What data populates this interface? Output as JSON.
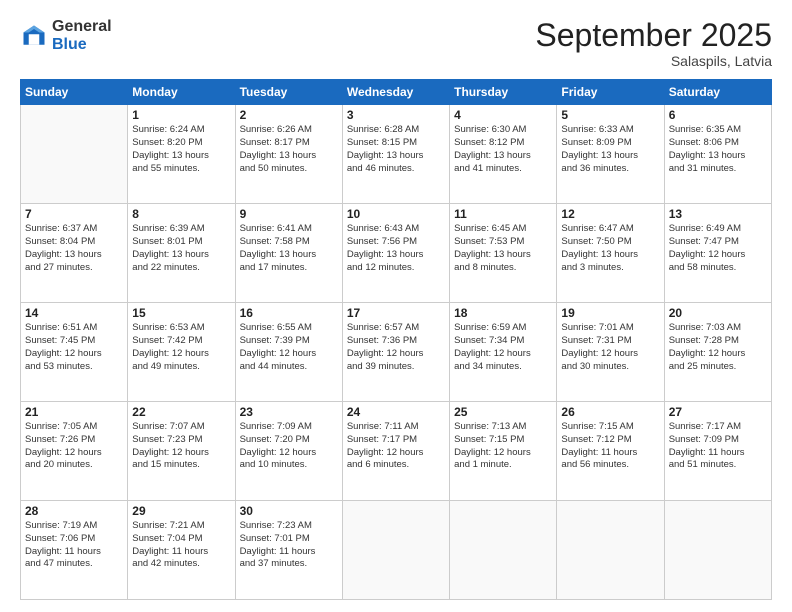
{
  "header": {
    "logo_general": "General",
    "logo_blue": "Blue",
    "month_title": "September 2025",
    "location": "Salaspils, Latvia"
  },
  "weekdays": [
    "Sunday",
    "Monday",
    "Tuesday",
    "Wednesday",
    "Thursday",
    "Friday",
    "Saturday"
  ],
  "weeks": [
    [
      {
        "day": "",
        "info": ""
      },
      {
        "day": "1",
        "info": "Sunrise: 6:24 AM\nSunset: 8:20 PM\nDaylight: 13 hours\nand 55 minutes."
      },
      {
        "day": "2",
        "info": "Sunrise: 6:26 AM\nSunset: 8:17 PM\nDaylight: 13 hours\nand 50 minutes."
      },
      {
        "day": "3",
        "info": "Sunrise: 6:28 AM\nSunset: 8:15 PM\nDaylight: 13 hours\nand 46 minutes."
      },
      {
        "day": "4",
        "info": "Sunrise: 6:30 AM\nSunset: 8:12 PM\nDaylight: 13 hours\nand 41 minutes."
      },
      {
        "day": "5",
        "info": "Sunrise: 6:33 AM\nSunset: 8:09 PM\nDaylight: 13 hours\nand 36 minutes."
      },
      {
        "day": "6",
        "info": "Sunrise: 6:35 AM\nSunset: 8:06 PM\nDaylight: 13 hours\nand 31 minutes."
      }
    ],
    [
      {
        "day": "7",
        "info": "Sunrise: 6:37 AM\nSunset: 8:04 PM\nDaylight: 13 hours\nand 27 minutes."
      },
      {
        "day": "8",
        "info": "Sunrise: 6:39 AM\nSunset: 8:01 PM\nDaylight: 13 hours\nand 22 minutes."
      },
      {
        "day": "9",
        "info": "Sunrise: 6:41 AM\nSunset: 7:58 PM\nDaylight: 13 hours\nand 17 minutes."
      },
      {
        "day": "10",
        "info": "Sunrise: 6:43 AM\nSunset: 7:56 PM\nDaylight: 13 hours\nand 12 minutes."
      },
      {
        "day": "11",
        "info": "Sunrise: 6:45 AM\nSunset: 7:53 PM\nDaylight: 13 hours\nand 8 minutes."
      },
      {
        "day": "12",
        "info": "Sunrise: 6:47 AM\nSunset: 7:50 PM\nDaylight: 13 hours\nand 3 minutes."
      },
      {
        "day": "13",
        "info": "Sunrise: 6:49 AM\nSunset: 7:47 PM\nDaylight: 12 hours\nand 58 minutes."
      }
    ],
    [
      {
        "day": "14",
        "info": "Sunrise: 6:51 AM\nSunset: 7:45 PM\nDaylight: 12 hours\nand 53 minutes."
      },
      {
        "day": "15",
        "info": "Sunrise: 6:53 AM\nSunset: 7:42 PM\nDaylight: 12 hours\nand 49 minutes."
      },
      {
        "day": "16",
        "info": "Sunrise: 6:55 AM\nSunset: 7:39 PM\nDaylight: 12 hours\nand 44 minutes."
      },
      {
        "day": "17",
        "info": "Sunrise: 6:57 AM\nSunset: 7:36 PM\nDaylight: 12 hours\nand 39 minutes."
      },
      {
        "day": "18",
        "info": "Sunrise: 6:59 AM\nSunset: 7:34 PM\nDaylight: 12 hours\nand 34 minutes."
      },
      {
        "day": "19",
        "info": "Sunrise: 7:01 AM\nSunset: 7:31 PM\nDaylight: 12 hours\nand 30 minutes."
      },
      {
        "day": "20",
        "info": "Sunrise: 7:03 AM\nSunset: 7:28 PM\nDaylight: 12 hours\nand 25 minutes."
      }
    ],
    [
      {
        "day": "21",
        "info": "Sunrise: 7:05 AM\nSunset: 7:26 PM\nDaylight: 12 hours\nand 20 minutes."
      },
      {
        "day": "22",
        "info": "Sunrise: 7:07 AM\nSunset: 7:23 PM\nDaylight: 12 hours\nand 15 minutes."
      },
      {
        "day": "23",
        "info": "Sunrise: 7:09 AM\nSunset: 7:20 PM\nDaylight: 12 hours\nand 10 minutes."
      },
      {
        "day": "24",
        "info": "Sunrise: 7:11 AM\nSunset: 7:17 PM\nDaylight: 12 hours\nand 6 minutes."
      },
      {
        "day": "25",
        "info": "Sunrise: 7:13 AM\nSunset: 7:15 PM\nDaylight: 12 hours\nand 1 minute."
      },
      {
        "day": "26",
        "info": "Sunrise: 7:15 AM\nSunset: 7:12 PM\nDaylight: 11 hours\nand 56 minutes."
      },
      {
        "day": "27",
        "info": "Sunrise: 7:17 AM\nSunset: 7:09 PM\nDaylight: 11 hours\nand 51 minutes."
      }
    ],
    [
      {
        "day": "28",
        "info": "Sunrise: 7:19 AM\nSunset: 7:06 PM\nDaylight: 11 hours\nand 47 minutes."
      },
      {
        "day": "29",
        "info": "Sunrise: 7:21 AM\nSunset: 7:04 PM\nDaylight: 11 hours\nand 42 minutes."
      },
      {
        "day": "30",
        "info": "Sunrise: 7:23 AM\nSunset: 7:01 PM\nDaylight: 11 hours\nand 37 minutes."
      },
      {
        "day": "",
        "info": ""
      },
      {
        "day": "",
        "info": ""
      },
      {
        "day": "",
        "info": ""
      },
      {
        "day": "",
        "info": ""
      }
    ]
  ]
}
